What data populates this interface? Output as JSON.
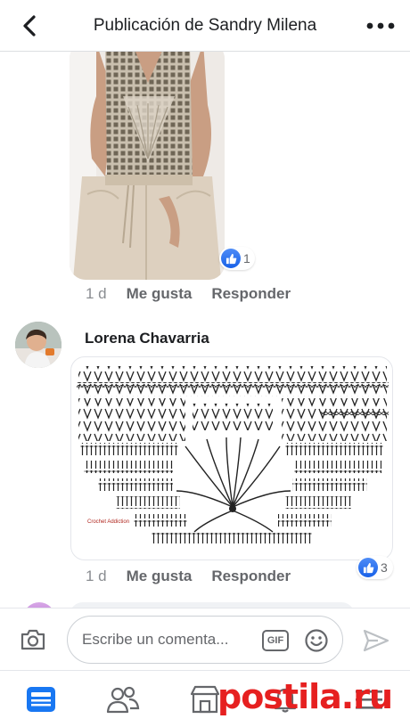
{
  "header": {
    "title": "Publicación de Sandry Milena",
    "back_icon": "chevron-left-icon",
    "more_icon": "more-dots-icon"
  },
  "comment1": {
    "reaction_count": "1",
    "time": "1 d",
    "like_label": "Me gusta",
    "reply_label": "Responder"
  },
  "comment2": {
    "author": "Lorena Chavarria",
    "diagram_watermark": "Crochet Addiction",
    "reaction_count": "3",
    "time": "1 d",
    "like_label": "Me gusta",
    "reply_label": "Responder"
  },
  "composer": {
    "placeholder": "Escribe un comenta...",
    "gif_label": "GIF"
  },
  "tabbar": {
    "items": [
      "feed-icon",
      "friends-icon",
      "marketplace-icon",
      "notifications-icon",
      "menu-icon"
    ]
  },
  "watermark": {
    "text": "postila.ru"
  },
  "colors": {
    "accent": "#1877f2",
    "text": "#1c1e21",
    "secondary": "#65676b",
    "watermark": "#e62020"
  }
}
